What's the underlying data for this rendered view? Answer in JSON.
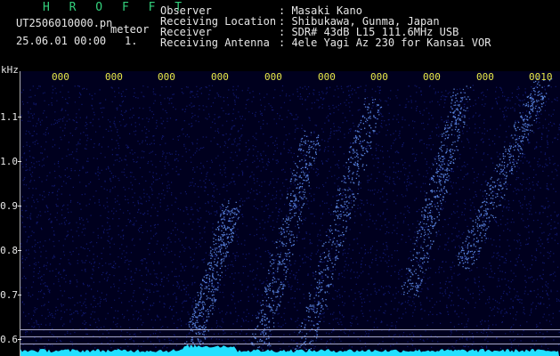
{
  "header": {
    "title": "H R O F F T",
    "filename": "UT2506010000.pn",
    "mode": "meteor",
    "datetime": "25.06.01 00:00",
    "page_number": "1.",
    "info_labels": [
      "Observer",
      "Receiving Location",
      "Receiver",
      "Receiving Antenna"
    ],
    "info_values": [
      ": Masaki Kano",
      ": Shibukawa, Gunma, Japan",
      ": SDR# 43dB L15 111.6MHz USB",
      ": 4ele Yagi Az 230 for Kansai VOR"
    ]
  },
  "axes": {
    "y_unit": "kHz",
    "y_ticks": [
      "1.1",
      "1.0",
      "0.9",
      "0.8",
      "0.7",
      "0.6"
    ],
    "x_ticks": [
      "000",
      "000",
      "000",
      "000",
      "000",
      "000",
      "000",
      "000",
      "000",
      "0010"
    ]
  },
  "colors": {
    "background": "#000000",
    "plot_background": "#00001e",
    "noise": "#1f2fb0",
    "bright_echo": "#6a9cff",
    "baseline": "#22e0ff",
    "title": "#33d07c",
    "tick_x": "#e8e84a",
    "text": "#e6e6e6"
  }
}
